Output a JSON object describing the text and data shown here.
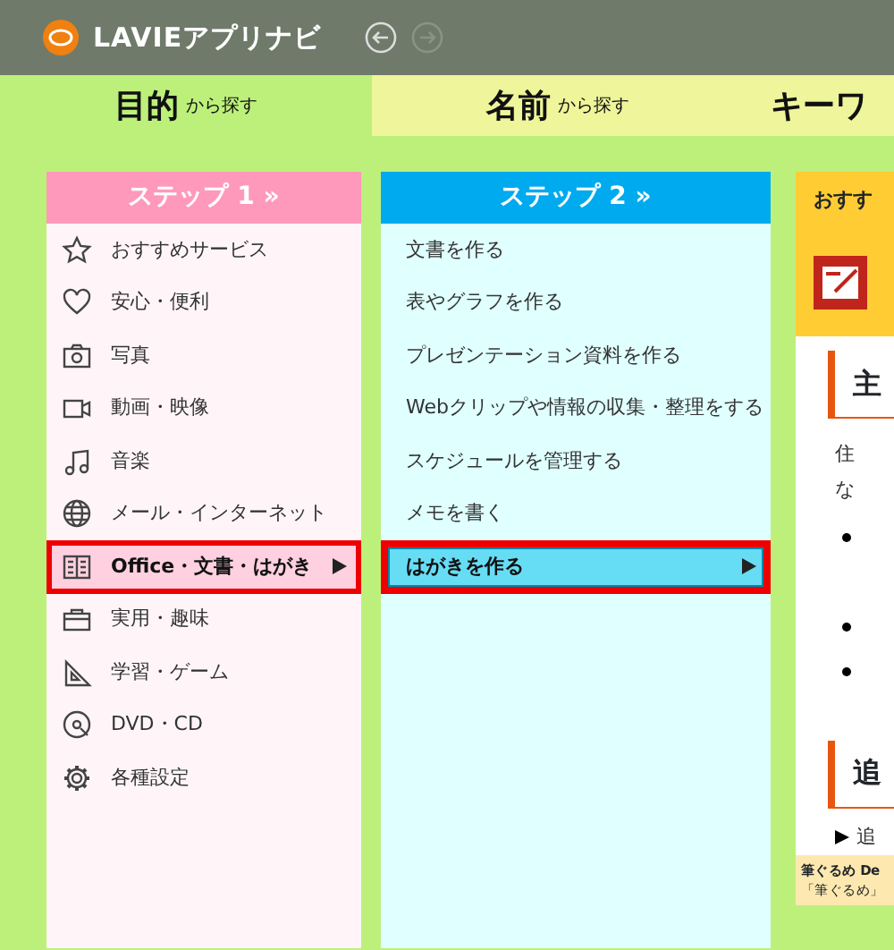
{
  "window": {
    "title": "LAVIEアプリナビ"
  },
  "tabs": [
    {
      "label": "目的",
      "suffix": "から探す",
      "selected": true
    },
    {
      "label": "名前",
      "suffix": "から探す",
      "selected": false
    },
    {
      "label": "キーワ",
      "selected": false
    }
  ],
  "step1": {
    "header": "ステップ 1 »",
    "items": [
      {
        "label": "おすすめサービス",
        "selected": false
      },
      {
        "label": "安心・便利",
        "selected": false
      },
      {
        "label": "写真",
        "selected": false
      },
      {
        "label": "動画・映像",
        "selected": false
      },
      {
        "label": "音楽",
        "selected": false
      },
      {
        "label": "メール・インターネット",
        "selected": false
      },
      {
        "label": "Office・文書・はがき",
        "selected": true
      },
      {
        "label": "実用・趣味",
        "selected": false
      },
      {
        "label": "学習・ゲーム",
        "selected": false
      },
      {
        "label": "DVD・CD",
        "selected": false
      },
      {
        "label": "各種設定",
        "selected": false
      }
    ]
  },
  "step2": {
    "header": "ステップ 2 »",
    "items": [
      {
        "label": "文書を作る",
        "selected": false
      },
      {
        "label": "表やグラフを作る",
        "selected": false
      },
      {
        "label": "プレゼンテーション資料を作る",
        "selected": false
      },
      {
        "label": "Webクリップや情報の収集・整理をする",
        "selected": false
      },
      {
        "label": "スケジュールを管理する",
        "selected": false
      },
      {
        "label": "メモを書く",
        "selected": false
      },
      {
        "label": "はがきを作る",
        "selected": true
      }
    ]
  },
  "detail": {
    "header": "おすす",
    "heading1": "主",
    "text_lines": [
      "住",
      "な"
    ],
    "heading2": "追",
    "link": "追",
    "footer_lines": [
      "筆ぐるめ De",
      "「筆ぐるめ」"
    ]
  }
}
